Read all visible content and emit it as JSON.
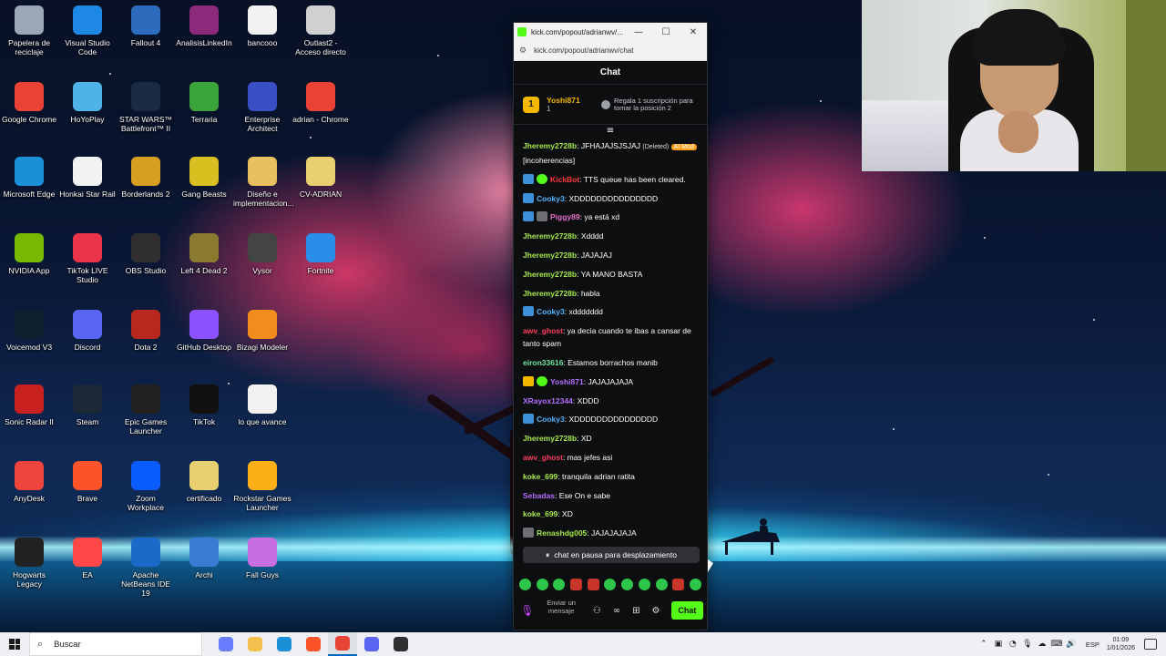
{
  "desktop": {
    "icons": [
      {
        "label": "Papelera de reciclaje",
        "color": "#9aa7b5"
      },
      {
        "label": "Visual Studio Code",
        "color": "#1e88e5"
      },
      {
        "label": "Fallout 4",
        "color": "#2d6bbd"
      },
      {
        "label": "AnalisisLinkedIn",
        "color": "#8b2a7a"
      },
      {
        "label": "bancooo",
        "color": "#f2f2f2"
      },
      {
        "label": "Outlast2 - Acceso directo",
        "color": "#d0d0d0"
      },
      {
        "label": "Google Chrome",
        "color": "#e84335"
      },
      {
        "label": "HoYoPlay",
        "color": "#4fb3e8"
      },
      {
        "label": "STAR WARS™ Battlefront™ II",
        "color": "#1a2a44"
      },
      {
        "label": "Terraria",
        "color": "#3aa33a"
      },
      {
        "label": "Enterprise Architect",
        "color": "#3b4fc4"
      },
      {
        "label": "adrian - Chrome",
        "color": "#e84335"
      },
      {
        "label": "Microsoft Edge",
        "color": "#1b8fd8"
      },
      {
        "label": "Honkai Star Rail",
        "color": "#f2f2f2"
      },
      {
        "label": "Borderlands 2",
        "color": "#d8a020"
      },
      {
        "label": "Gang Beasts",
        "color": "#d8c020"
      },
      {
        "label": "Diseño e implementacion...",
        "color": "#e8c060"
      },
      {
        "label": "CV-ADRIAN",
        "color": "#e8d070"
      },
      {
        "label": "NVIDIA App",
        "color": "#76b900"
      },
      {
        "label": "TikTok LIVE Studio",
        "color": "#e8334a"
      },
      {
        "label": "OBS Studio",
        "color": "#302e31"
      },
      {
        "label": "Left 4 Dead 2",
        "color": "#8a7a30"
      },
      {
        "label": "Vysor",
        "color": "#444444"
      },
      {
        "label": "Fortnite",
        "color": "#2a8ee8"
      },
      {
        "label": "Voicemod V3",
        "color": "#0f1f2f"
      },
      {
        "label": "Discord",
        "color": "#5865f2"
      },
      {
        "label": "Dota 2",
        "color": "#b8281e"
      },
      {
        "label": "GitHub Desktop",
        "color": "#8c52ff"
      },
      {
        "label": "Bizagi Modeler",
        "color": "#f28c1e"
      },
      {
        "label": "Sonic Radar II",
        "color": "#c8201e"
      },
      {
        "label": "Steam",
        "color": "#1b2838"
      },
      {
        "label": "Epic Games Launcher",
        "color": "#222222"
      },
      {
        "label": "TikTok",
        "color": "#111111"
      },
      {
        "label": "lo que avance",
        "color": "#f2f2f2"
      },
      {
        "label": "AnyDesk",
        "color": "#ef443b"
      },
      {
        "label": "Brave",
        "color": "#fb542b"
      },
      {
        "label": "Zoom Workplace",
        "color": "#0b5cff"
      },
      {
        "label": "certificado",
        "color": "#e8d070"
      },
      {
        "label": "Rockstar Games Launcher",
        "color": "#fcaf17"
      },
      {
        "label": "Hogwarts Legacy",
        "color": "#222222"
      },
      {
        "label": "EA",
        "color": "#ff4747"
      },
      {
        "label": "Apache NetBeans IDE 19",
        "color": "#1b6ac9"
      },
      {
        "label": "Archi",
        "color": "#3a7bd5"
      },
      {
        "label": "Fall Guys",
        "color": "#c86ee0"
      }
    ]
  },
  "window": {
    "title": "kick.com/popout/adrianwv/...",
    "url": "kick.com/popout/adrianwv/chat",
    "minimize_glyph": "—",
    "maximize_glyph": "☐",
    "close_glyph": "✕"
  },
  "chat": {
    "header": "Chat",
    "pinned": {
      "rank": "1",
      "user": "Yoshi871",
      "count": "1",
      "gift_text": "Regala 1 suscripción para tomar la posición 2"
    },
    "collapse_glyph": "≡",
    "messages": [
      {
        "user": "Jheremy2728b",
        "color": "#a7e84a",
        "text": "JFHAJAJSJSJAJ",
        "deleted": "(Deleted)",
        "mod_tag": "AI Mod",
        "extra": "[incoherencias]",
        "badges": []
      },
      {
        "user": "KickBot",
        "color": "#ff3b3b",
        "text": "TTS queue has been cleared.",
        "badges": [
          "blue",
          "green"
        ]
      },
      {
        "user": "Cooky3",
        "color": "#4fb3ff",
        "text": "XDDDDDDDDDDDDDDD",
        "badges": [
          "blue"
        ]
      },
      {
        "user": "Piggy89",
        "color": "#e86ecb",
        "text": "ya está xd",
        "badges": [
          "blue",
          "gray"
        ]
      },
      {
        "user": "Jheremy2728b",
        "color": "#a7e84a",
        "text": "Xdddd",
        "badges": []
      },
      {
        "user": "Jheremy2728b",
        "color": "#a7e84a",
        "text": "JAJAJAJ",
        "badges": []
      },
      {
        "user": "Jheremy2728b",
        "color": "#a7e84a",
        "text": "YA MANO BASTA",
        "badges": []
      },
      {
        "user": "Jheremy2728b",
        "color": "#a7e84a",
        "text": "habla",
        "badges": []
      },
      {
        "user": "Cooky3",
        "color": "#4fb3ff",
        "text": "xddddddd",
        "badges": [
          "blue"
        ]
      },
      {
        "user": "awv_ghost",
        "color": "#ff3b5c",
        "text": "ya decia cuando te ibas a cansar de tanto spam",
        "badges": []
      },
      {
        "user": "eiron33616",
        "color": "#6ee8a0",
        "text": "Estamos borrachos manib",
        "badges": []
      },
      {
        "user": "Yoshi871",
        "color": "#b36eff",
        "text": "JAJAJAJAJA",
        "badges": [
          "gold",
          "green"
        ]
      },
      {
        "user": "XRayox12344",
        "color": "#b36eff",
        "text": "XDDD",
        "badges": []
      },
      {
        "user": "Cooky3",
        "color": "#4fb3ff",
        "text": "XDDDDDDDDDDDDDDD",
        "badges": [
          "blue"
        ]
      },
      {
        "user": "Jheremy2728b",
        "color": "#a7e84a",
        "text": "XD",
        "badges": []
      },
      {
        "user": "awv_ghost",
        "color": "#ff3b5c",
        "text": "mas jefes asi",
        "badges": []
      },
      {
        "user": "koke_699",
        "color": "#a7e84a",
        "text": "tranquila adrian ratita",
        "badges": []
      },
      {
        "user": "Sebadas",
        "color": "#b36eff",
        "text": "Ese On e sabe",
        "badges": []
      },
      {
        "user": "koke_699",
        "color": "#a7e84a",
        "text": "XD",
        "badges": []
      },
      {
        "user": "Renashdg005",
        "color": "#a7e84a",
        "text": "JAJAJAJAJA",
        "badges": [
          "gray"
        ]
      }
    ],
    "pause_text": "chat en pausa para desplazamiento",
    "pause_glyph": "⏸",
    "input_placeholder": "Enviar un mensaje",
    "mic_glyph": "🎙",
    "tool_glyphs": [
      "⚇",
      "∞",
      "⊞",
      "⚙"
    ],
    "send_label": "Chat"
  },
  "taskbar": {
    "search_placeholder": "Buscar",
    "search_glyph": "⌕",
    "apps": [
      {
        "name": "copilot",
        "color": "#6a7bff"
      },
      {
        "name": "file-explorer",
        "color": "#f2c14e"
      },
      {
        "name": "edge",
        "color": "#1b8fd8"
      },
      {
        "name": "brave",
        "color": "#fb542b"
      },
      {
        "name": "chrome",
        "color": "#e84335"
      },
      {
        "name": "discord",
        "color": "#5865f2"
      },
      {
        "name": "obs",
        "color": "#302e31"
      }
    ],
    "tray_glyphs": [
      "⌃",
      "▣",
      "◔",
      "🎙",
      "☁",
      "⌨",
      "🔊"
    ],
    "lang": "ESP",
    "time": "01:09",
    "date": "1/01/2026"
  }
}
